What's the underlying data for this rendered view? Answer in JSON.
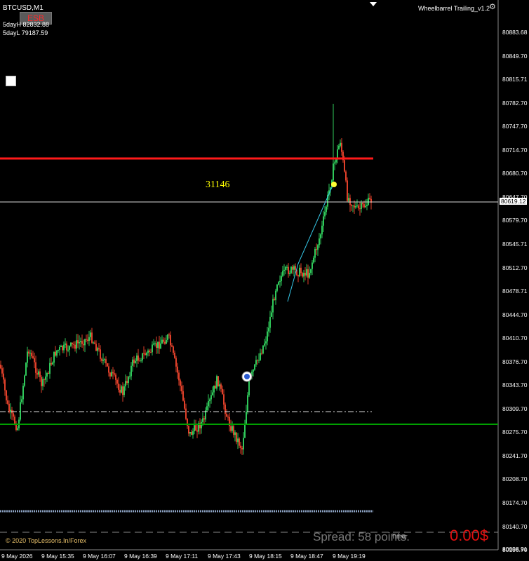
{
  "window": {
    "symbol": "BTCUSD,M1"
  },
  "panel": {
    "esb_label": "ESB",
    "high_5d": "5dayH 82832.88",
    "low_5d": "5dayL 79187.59"
  },
  "indicator": {
    "name": "Wheelbarrel Trailing_v1.2",
    "gear": "gear-icon"
  },
  "annotations": {
    "big_number": "31146",
    "copyright": "© 2020 TopLessons.In/Forex",
    "spread": "Spread: 58 points.",
    "profit": "0.00$",
    "small_label": "Timer"
  },
  "price_axis": {
    "labels": [
      "80883.68",
      "80849.70",
      "80815.71",
      "80782.70",
      "80747.70",
      "80714.70",
      "80680.70",
      "80647.70",
      "80579.70",
      "80545.71",
      "80512.70",
      "80478.71",
      "80444.70",
      "80410.70",
      "80376.70",
      "80343.70",
      "80309.70",
      "80275.70",
      "80241.70",
      "80208.70",
      "80174.70",
      "80140.70",
      "80106.70"
    ],
    "current": "80619.12",
    "last": "80098.91"
  },
  "time_axis": {
    "labels": [
      "9 May 2026",
      "9 May 15:35",
      "9 May 16:07",
      "9 May 16:39",
      "9 May 17:11",
      "9 May 17:43",
      "9 May 18:15",
      "9 May 18:47",
      "9 May 19:19"
    ]
  },
  "colors": {
    "bull": "#2fc85a",
    "bear": "#e0402a",
    "red_level": "#ff1a1a",
    "green_level": "#00a000",
    "trend_line": "#36c8e8"
  }
}
